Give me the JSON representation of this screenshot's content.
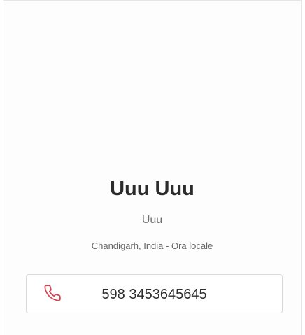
{
  "profile": {
    "name": "Uuu Uuu",
    "role": "Uuu",
    "location": "Chandigarh, India - Ora locale"
  },
  "contact": {
    "phone": "598 3453645645",
    "icon": "phone-icon",
    "icon_color": "#d9434f"
  }
}
